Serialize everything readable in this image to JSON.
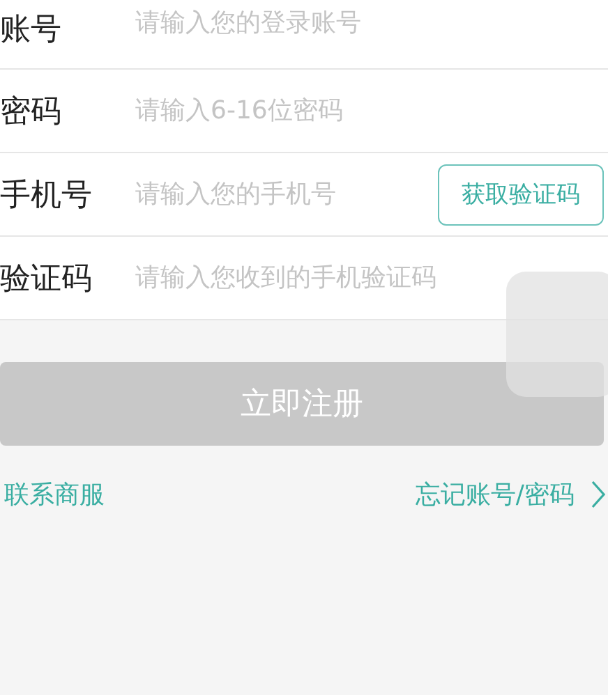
{
  "fields": [
    {
      "label": "账号",
      "placeholder": "请输入您的登录账号"
    },
    {
      "label": "密码",
      "placeholder": "请输入6-16位密码"
    },
    {
      "label": "手机号",
      "placeholder": "请输入您的手机号",
      "action": "获取验证码"
    },
    {
      "label": "验证码",
      "placeholder": "请输入您收到的手机验证码"
    }
  ],
  "register_button": {
    "label": "立即注册",
    "disabled": true
  },
  "links": {
    "contact": "联系商服",
    "forgot": "忘记账号/密码"
  }
}
